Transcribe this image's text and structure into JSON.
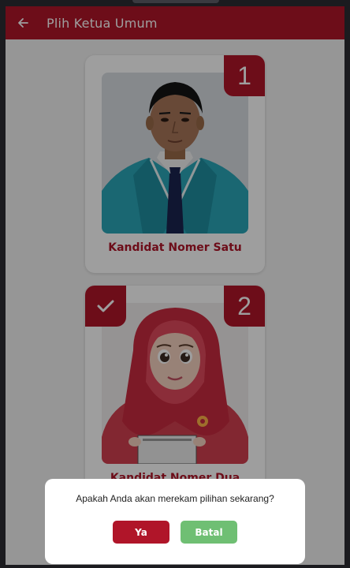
{
  "appbar": {
    "title": "Plih Ketua Umum",
    "back_icon": "arrow-left-icon",
    "color": "#b01529"
  },
  "candidates": [
    {
      "number": "1",
      "name": "Kandidat Nomer Satu",
      "selected": false
    },
    {
      "number": "2",
      "name": "Kandidat Nomer Dua",
      "selected": true
    }
  ],
  "dialog": {
    "message": "Apakah Anda akan merekam pilihan sekarang?",
    "confirm_label": "Ya",
    "cancel_label": "Batal",
    "confirm_color": "#b01529",
    "cancel_color": "#6fbf73"
  }
}
